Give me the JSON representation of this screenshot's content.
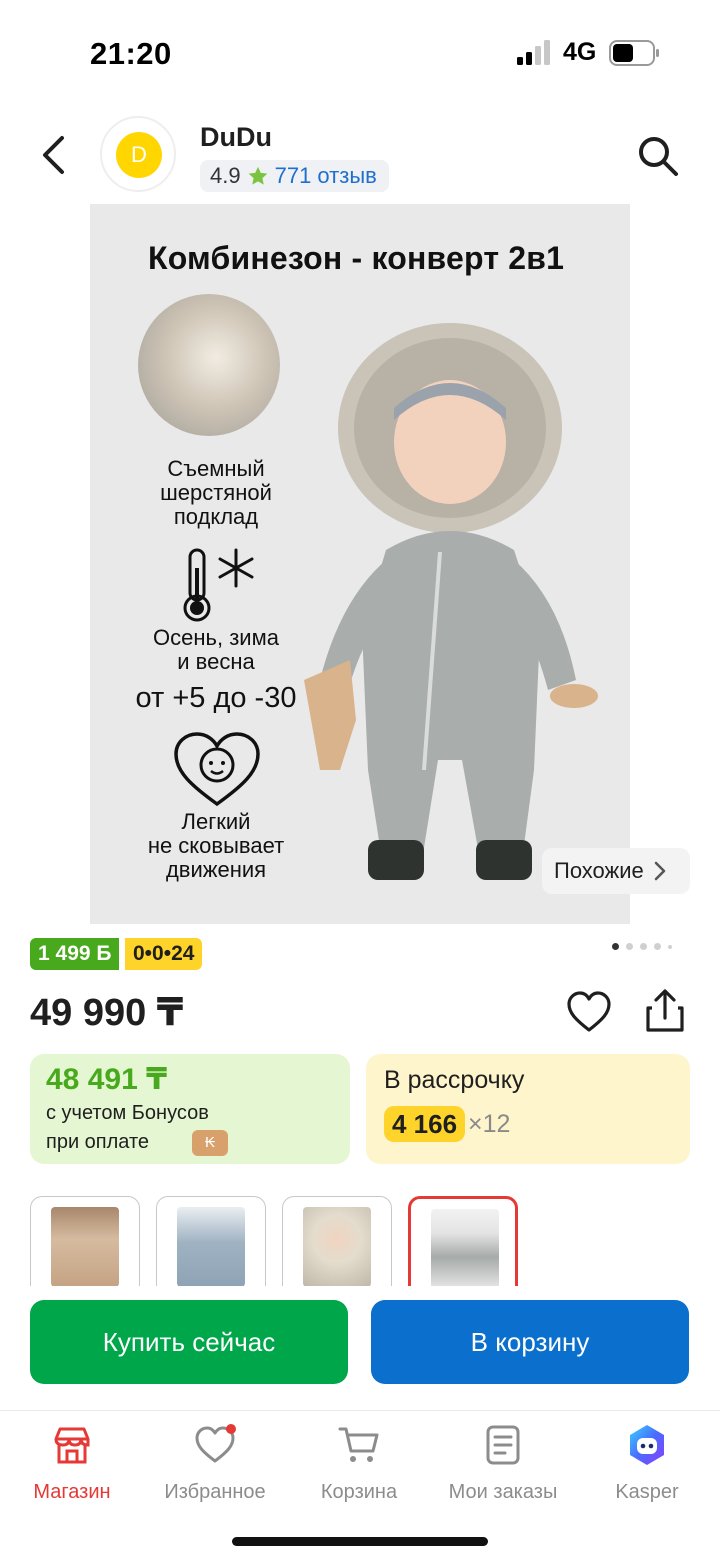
{
  "status_bar": {
    "time": "21:20",
    "network": "4G"
  },
  "header": {
    "seller_logo_letter": "D",
    "seller_name": "DuDu",
    "rating": "4.9",
    "reviews": "771 отзыв"
  },
  "product_image": {
    "title": "Комбинезон - конверт 2в1",
    "feature1_lines": [
      "Съемный",
      "шерстяной",
      "подклад"
    ],
    "feature2_lines": [
      "Осень, зима",
      "и весна"
    ],
    "temperature": "от +5 до -30",
    "feature3_lines": [
      "Легкий",
      "не сковывает",
      "движения"
    ]
  },
  "similar_button": {
    "label": "Похожие"
  },
  "badges": {
    "bonus": "1 499 Б",
    "installment": "0•0•24"
  },
  "gallery": {
    "page_count": 5,
    "active_index": 0
  },
  "price": {
    "value": "49 990 ₸"
  },
  "bonus_card": {
    "amount": "48 491 ₸",
    "line1": "с учетом Бонусов",
    "line2": "при оплате"
  },
  "installment_card": {
    "title": "В рассрочку",
    "amount": "4 166",
    "multiplier": "×12"
  },
  "thumbnails": {
    "selected_index": 3,
    "count": 4
  },
  "actions": {
    "buy_now": "Купить сейчас",
    "add_to_cart": "В корзину"
  },
  "tabbar": {
    "items": [
      {
        "label": "Магазин",
        "icon": "shop-icon",
        "active": true
      },
      {
        "label": "Избранное",
        "icon": "heart-icon",
        "active": false
      },
      {
        "label": "Корзина",
        "icon": "cart-icon",
        "active": false
      },
      {
        "label": "Мои заказы",
        "icon": "orders-icon",
        "active": false
      },
      {
        "label": "Kasper",
        "icon": "kasper-assistant-icon",
        "active": false
      }
    ]
  },
  "colors": {
    "accent_red": "#e53935",
    "buy_green": "#00a74a",
    "cart_blue": "#0a6fcd",
    "bonus_green": "#48a91c",
    "installment_yellow": "#fed42b"
  }
}
